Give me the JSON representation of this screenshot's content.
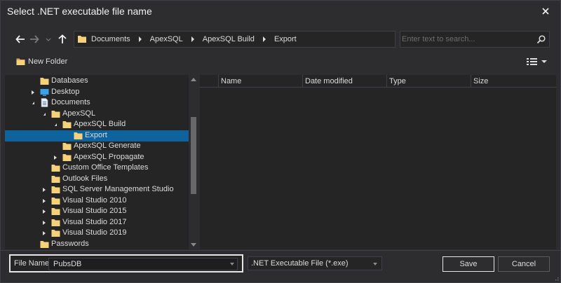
{
  "window": {
    "title": "Select .NET executable file name"
  },
  "nav": {
    "breadcrumb": [
      "Documents",
      "ApexSQL",
      "ApexSQL Build",
      "Export"
    ],
    "search_placeholder": "Enter text to search..."
  },
  "toolbar": {
    "new_folder_label": "New Folder"
  },
  "tree": {
    "items": [
      {
        "label": "Databases",
        "level": 2,
        "expander": "none",
        "icon": "folder-icon"
      },
      {
        "label": "Desktop",
        "level": 2,
        "expander": "collapsed",
        "icon": "desktop-icon"
      },
      {
        "label": "Documents",
        "level": 2,
        "expander": "expanded",
        "icon": "documents-icon"
      },
      {
        "label": "ApexSQL",
        "level": 3,
        "expander": "expanded",
        "icon": "folder-icon"
      },
      {
        "label": "ApexSQL Build",
        "level": 4,
        "expander": "expanded",
        "icon": "folder-icon"
      },
      {
        "label": "Export",
        "level": 5,
        "expander": "none",
        "icon": "folder-icon",
        "selected": true
      },
      {
        "label": "ApexSQL Generate",
        "level": 4,
        "expander": "none",
        "icon": "folder-icon"
      },
      {
        "label": "ApexSQL Propagate",
        "level": 4,
        "expander": "collapsed",
        "icon": "folder-icon"
      },
      {
        "label": "Custom Office Templates",
        "level": 3,
        "expander": "none",
        "icon": "folder-icon"
      },
      {
        "label": "Outlook Files",
        "level": 3,
        "expander": "none",
        "icon": "folder-icon"
      },
      {
        "label": "SQL Server Management Studio",
        "level": 3,
        "expander": "collapsed",
        "icon": "folder-icon"
      },
      {
        "label": "Visual Studio 2010",
        "level": 3,
        "expander": "collapsed",
        "icon": "folder-icon"
      },
      {
        "label": "Visual Studio 2015",
        "level": 3,
        "expander": "collapsed",
        "icon": "folder-icon"
      },
      {
        "label": "Visual Studio 2017",
        "level": 3,
        "expander": "collapsed",
        "icon": "folder-icon"
      },
      {
        "label": "Visual Studio 2019",
        "level": 3,
        "expander": "collapsed",
        "icon": "folder-icon"
      },
      {
        "label": "Passwords",
        "level": 2,
        "expander": "none",
        "icon": "folder-icon"
      }
    ]
  },
  "files": {
    "columns": [
      "Name",
      "Date modified",
      "Type",
      "Size"
    ],
    "rows": []
  },
  "bottom": {
    "file_name_label": "File Name:",
    "file_name_value": "PubsDB",
    "file_type_value": ".NET Executable File (*.exe)",
    "save_label": "Save",
    "cancel_label": "Cancel"
  },
  "colors": {
    "accent": "#0e639c",
    "folder": "#f5d27a",
    "background": "#2d2d30",
    "pane": "#252526"
  }
}
